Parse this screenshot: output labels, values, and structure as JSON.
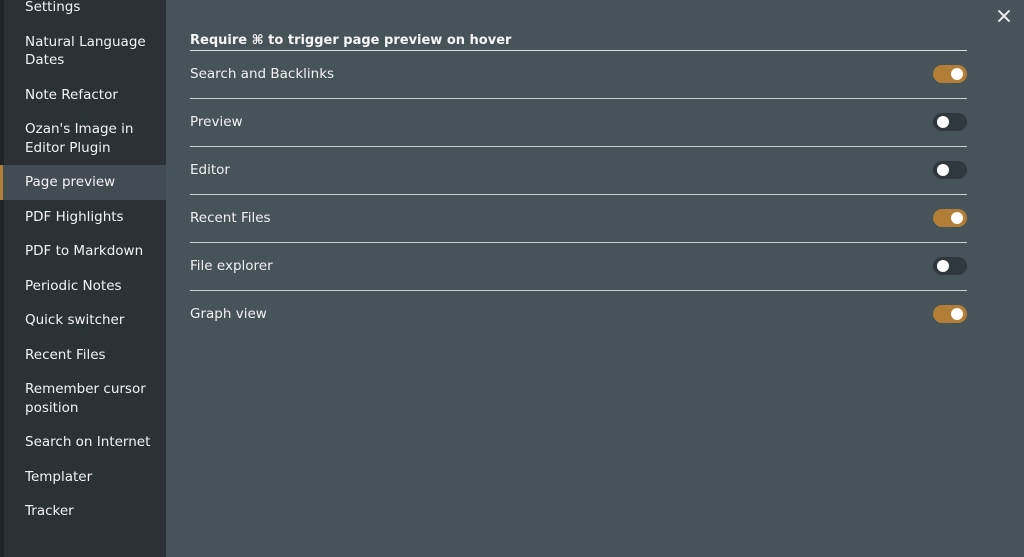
{
  "sidebar": {
    "items": [
      {
        "label": "Settings",
        "active": false
      },
      {
        "label": "Natural Language Dates",
        "active": false
      },
      {
        "label": "Note Refactor",
        "active": false
      },
      {
        "label": "Ozan's Image in Editor Plugin",
        "active": false
      },
      {
        "label": "Page preview",
        "active": true
      },
      {
        "label": "PDF Highlights",
        "active": false
      },
      {
        "label": "PDF to Markdown",
        "active": false
      },
      {
        "label": "Periodic Notes",
        "active": false
      },
      {
        "label": "Quick switcher",
        "active": false
      },
      {
        "label": "Recent Files",
        "active": false
      },
      {
        "label": "Remember cursor position",
        "active": false
      },
      {
        "label": "Search on Internet",
        "active": false
      },
      {
        "label": "Templater",
        "active": false
      },
      {
        "label": "Tracker",
        "active": false
      }
    ]
  },
  "close": {
    "icon": "close-icon"
  },
  "section": {
    "title": "Require ⌘ to trigger page preview on hover"
  },
  "settings": [
    {
      "label": "Search and Backlinks",
      "enabled": true
    },
    {
      "label": "Preview",
      "enabled": false
    },
    {
      "label": "Editor",
      "enabled": false
    },
    {
      "label": "Recent Files",
      "enabled": true
    },
    {
      "label": "File explorer",
      "enabled": false
    },
    {
      "label": "Graph view",
      "enabled": true
    }
  ],
  "colors": {
    "accent": "#b27d36",
    "sidebar_bg": "#2b3235",
    "content_bg": "#465359"
  }
}
